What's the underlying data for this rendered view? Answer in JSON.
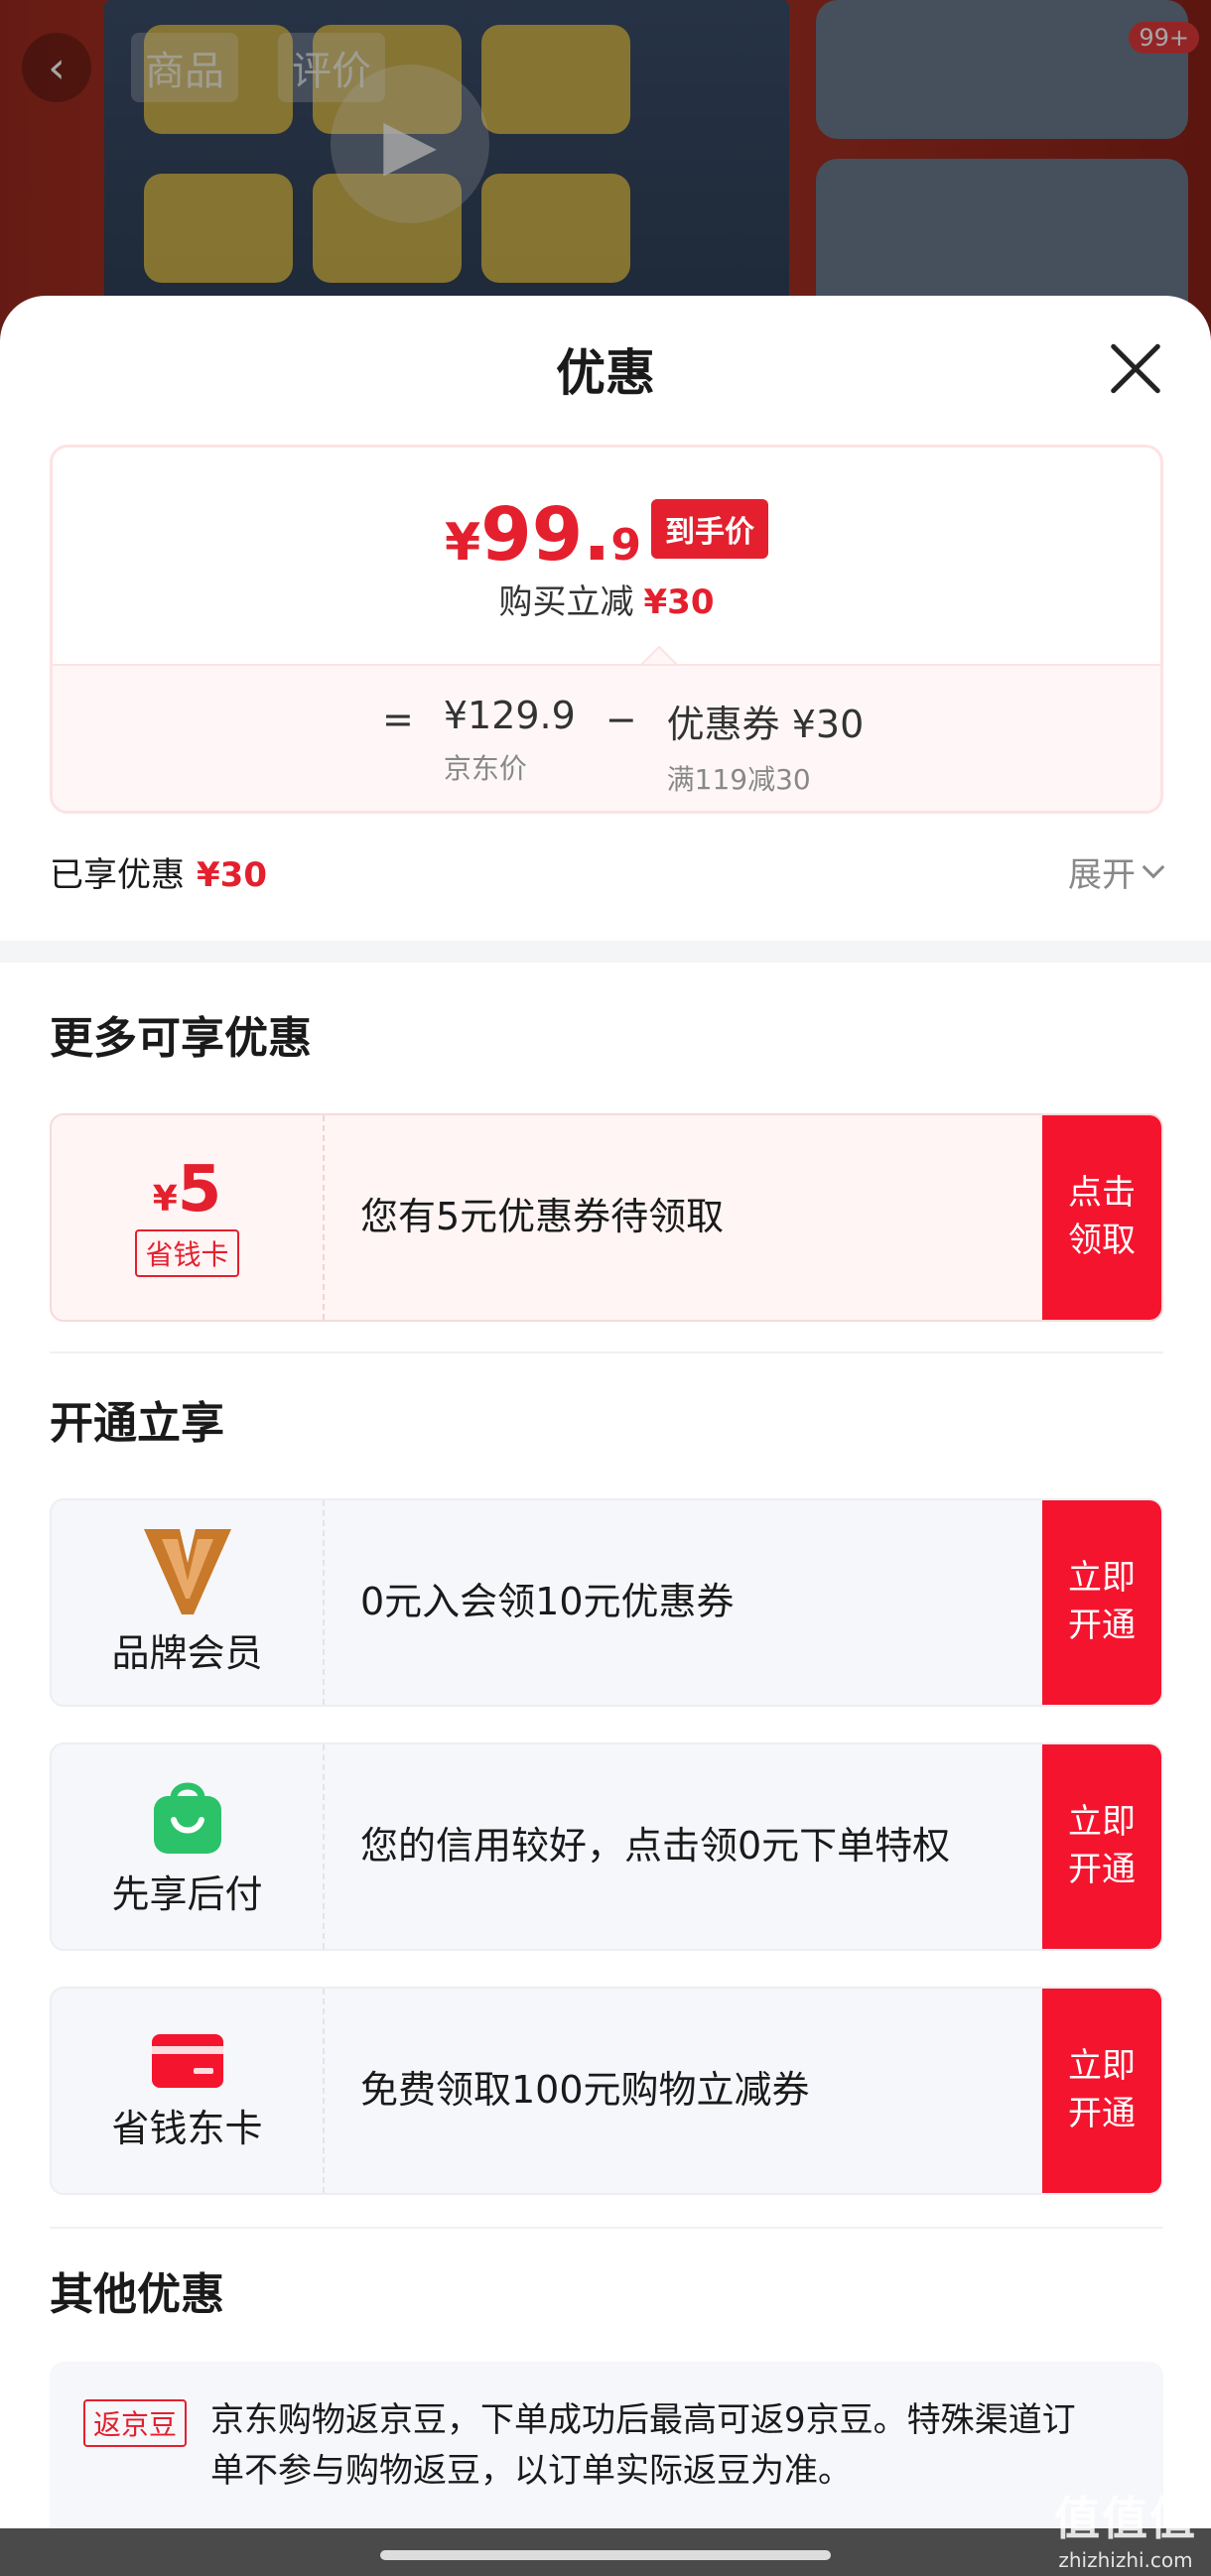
{
  "background": {
    "tabs": [
      "商品",
      "评价"
    ],
    "back_icon": "‹",
    "badge": "99+",
    "play_icon": "▶"
  },
  "sheet": {
    "title": "优惠",
    "close_icon": "close-icon"
  },
  "price_card": {
    "final_symbol": "¥",
    "final_integer": "99.",
    "final_decimal": "9",
    "final_tag": "到手价",
    "reduce_label": "购买立减",
    "reduce_amount": "¥30",
    "equals": "=",
    "minus": "−",
    "jd_price": "¥129.9",
    "jd_price_label": "京东价",
    "coupon_value": "优惠券 ¥30",
    "coupon_rule": "满119减30"
  },
  "enjoyed": {
    "label": "已享优惠",
    "amount": "¥30",
    "expand": "展开"
  },
  "more": {
    "title": "更多可享优惠",
    "coupon_symbol": "¥",
    "coupon_amount": "5",
    "coupon_tag": "省钱卡",
    "text": "您有5元优惠券待领取",
    "button": "点击领取"
  },
  "open": {
    "title": "开通立享",
    "items": [
      {
        "name": "品牌会员",
        "text": "0元入会领10元优惠券",
        "button": "立即开通"
      },
      {
        "name": "先享后付",
        "text": "您的信用较好，点击领0元下单特权",
        "button": "立即开通"
      },
      {
        "name": "省钱东卡",
        "text": "免费领取100元购物立减券",
        "button": "立即开通"
      }
    ]
  },
  "other": {
    "title": "其他优惠",
    "tag": "返京豆",
    "text": "京东购物返京豆，下单成功后最高可返9京豆。特殊渠道订单不参与购物返豆，以订单实际返豆为准。"
  },
  "watermark": {
    "big": "值值值",
    "small": "zhizhizhi.com"
  },
  "colors": {
    "accent": "#e4202e",
    "button_red": "#f5142e",
    "brand_member_orange": "#c8792a",
    "pay_green": "#2bc26a"
  }
}
